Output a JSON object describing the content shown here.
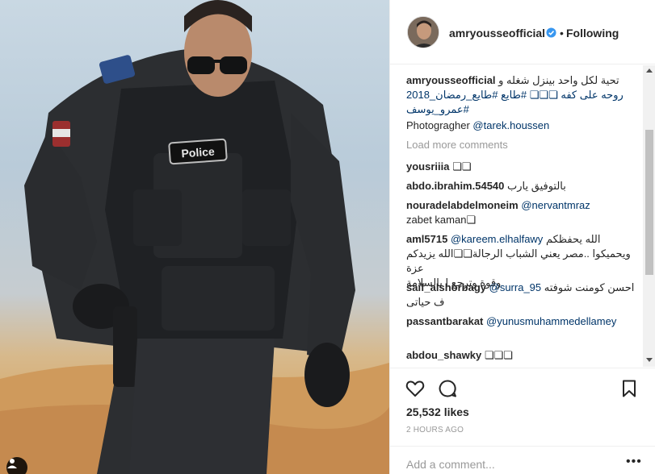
{
  "post": {
    "username": "amryousseofficial",
    "follow_status": "Following",
    "dot": "•",
    "caption_line1": "تحية لكل واحد بينزل شغله و",
    "caption_line2": "روحه على كفه ❏❏❏ #طايع #طايع_رمضان_2018",
    "caption_line3": "#عمرو_يوسف",
    "photographer_label": "Photogragher",
    "photographer_handle": "@tarek.houssen",
    "patch_text": "Police",
    "load_more": "Load more comments",
    "likes": "25,532 likes",
    "time": "2 HOURS AGO",
    "add_comment_placeholder": "Add a comment...",
    "more_options": "•••"
  },
  "comments": [
    {
      "user": "yousriiia",
      "text": "❏❏"
    },
    {
      "user": "abdo.ibrahim.54540",
      "text": "بالتوفيق يارب"
    },
    {
      "user": "nouradelabdelmoneim",
      "mention": "@nervantmraz",
      "text": "zabet kaman❏"
    },
    {
      "user": "aml5715",
      "mention": "@kareem.elhalfawy",
      "text": "الله يحفظكم",
      "line2": "ويحميكوا ..مصر يعني الشباب الرجالة❏❏الله يزيدكم عزة",
      "line3": "وقوة وترجع ا بالسلامة"
    },
    {
      "user": "saif_alshorbagy",
      "mention": "@surra_95",
      "text": "احسن كومنت شوفته",
      "line2": "ف حياتى"
    },
    {
      "user": "passantbarakat",
      "mention": "@yunusmuhammedellamey"
    },
    {
      "user": "abdou_shawky",
      "text": "❏❏❏"
    }
  ],
  "colors": {
    "link": "#003569",
    "muted": "#999999",
    "verified": "#3897f0"
  },
  "icons": [
    "heart-icon",
    "comment-icon",
    "bookmark-icon",
    "verified-badge-icon",
    "user-tag-icon"
  ]
}
